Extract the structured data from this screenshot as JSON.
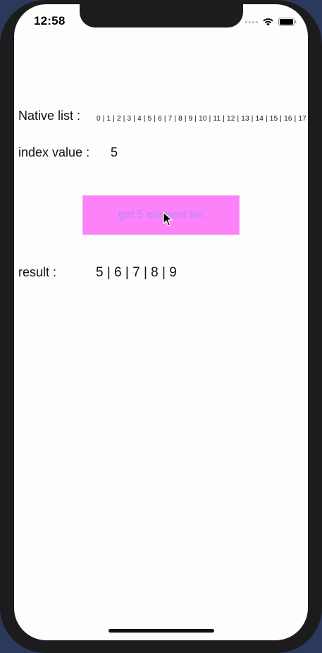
{
  "status_bar": {
    "time": "12:58",
    "icons": [
      "signal-dots-icon",
      "wifi-icon",
      "battery-icon"
    ]
  },
  "native_list": {
    "label": "Native list :",
    "values_text": "0 | 1 | 2 | 3 | 4 | 5 | 6 | 7 | 8 | 9 | 10 | 11 | 12 | 13 | 14 | 15 | 16 | 17"
  },
  "index": {
    "label": "index value :",
    "value": "5"
  },
  "action_button": {
    "label": "get 5 element list",
    "background": "#fd82fa",
    "text_color": "#b68af0"
  },
  "result": {
    "label": "result :",
    "value": "5 | 6 | 7 | 8 | 9"
  }
}
